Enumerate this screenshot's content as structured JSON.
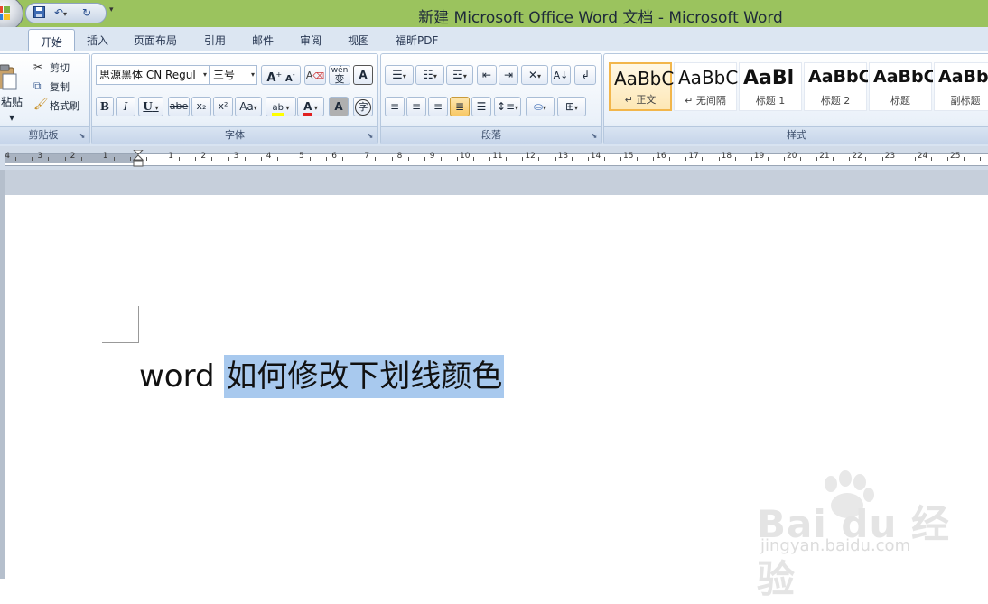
{
  "window": {
    "title": "新建 Microsoft Office Word 文档 - Microsoft Word"
  },
  "quick_access": {
    "items": [
      "save-icon",
      "undo-icon",
      "redo-icon",
      "customize-dropdown-icon"
    ]
  },
  "tabs": [
    {
      "label": "开始",
      "active": true
    },
    {
      "label": "插入"
    },
    {
      "label": "页面布局"
    },
    {
      "label": "引用"
    },
    {
      "label": "邮件"
    },
    {
      "label": "审阅"
    },
    {
      "label": "视图"
    },
    {
      "label": "福昕PDF"
    }
  ],
  "ribbon": {
    "clipboard": {
      "label": "剪贴板",
      "paste": "粘贴",
      "cut": "剪切",
      "copy": "复制",
      "format_painter": "格式刷"
    },
    "font": {
      "label": "字体",
      "font_name": "思源黑体 CN Regul",
      "font_size": "三号",
      "bold": "B",
      "italic": "I",
      "underline": "U",
      "strikethrough": "abe",
      "subscript": "x₂",
      "superscript": "x²",
      "change_case": "Aa",
      "grow": "A",
      "shrink": "A",
      "clear_format": "A",
      "text_effect": "A",
      "font_color": "A",
      "phonetic": "wén",
      "encircle": "字",
      "border": "A",
      "highlight": "ab"
    },
    "paragraph": {
      "label": "段落"
    },
    "styles": {
      "label": "样式",
      "items": [
        {
          "preview": "AaBbCcDc",
          "name": "↵ 正文",
          "selected": true
        },
        {
          "preview": "AaBbCcDc",
          "name": "↵ 无间隔"
        },
        {
          "preview": "AaBl",
          "name": "标题 1"
        },
        {
          "preview": "AaBbC",
          "name": "标题 2"
        },
        {
          "preview": "AaBbC",
          "name": "标题"
        },
        {
          "preview": "AaBbC",
          "name": "副标题"
        }
      ]
    }
  },
  "ruler": {
    "left_labels": [
      "4",
      "3",
      "2",
      "1"
    ],
    "labels": [
      "1",
      "2",
      "3",
      "4",
      "5",
      "6",
      "7",
      "8",
      "9",
      "10",
      "11",
      "12",
      "13",
      "14",
      "15",
      "16",
      "17",
      "18",
      "19",
      "20",
      "21",
      "22",
      "23",
      "24",
      "25"
    ]
  },
  "document": {
    "text_plain": "word ",
    "text_selected": "如何修改下划线颜色"
  },
  "watermark": {
    "brand": "Bai du 经验",
    "url": "jingyan.baidu.com"
  },
  "colors": {
    "title_bar": "#9bc35e",
    "selection": "#a8c9ee",
    "highlight_yellow": "#ffff00",
    "font_red": "#e02020"
  }
}
